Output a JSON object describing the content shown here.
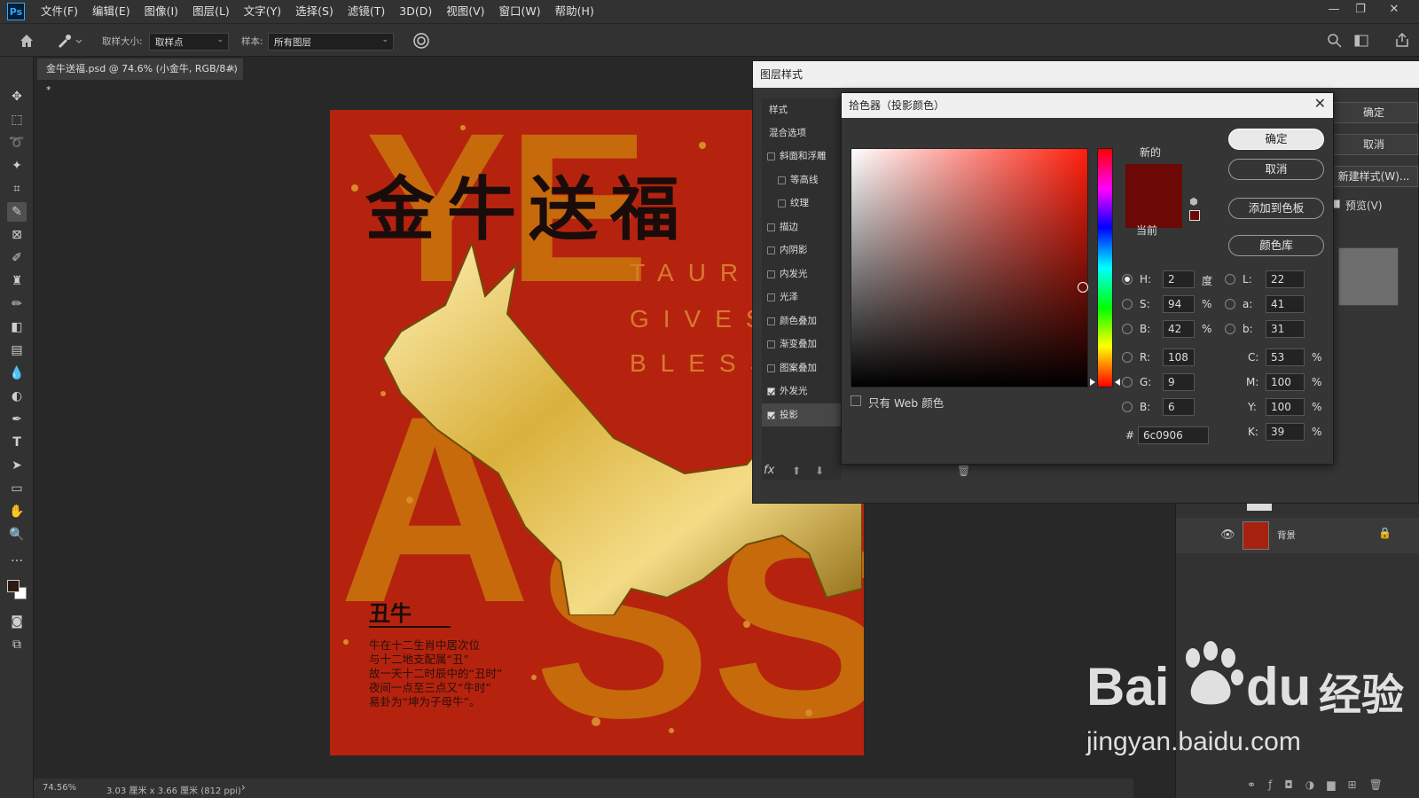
{
  "menubar": {
    "logo": "Ps",
    "items": [
      "文件(F)",
      "编辑(E)",
      "图像(I)",
      "图层(L)",
      "文字(Y)",
      "选择(S)",
      "滤镜(T)",
      "3D(D)",
      "视图(V)",
      "窗口(W)",
      "帮助(H)"
    ]
  },
  "optbar": {
    "sample_size_label": "取样大小:",
    "sample_size_value": "取样点",
    "sample_label": "样本:",
    "sample_value": "所有图层"
  },
  "document_tab": {
    "title": "金牛送福.psd @ 74.6% (小金牛, RGB/8#) *",
    "close": "×"
  },
  "poster": {
    "title": "金牛送福",
    "subtitle_lines": [
      "TAURUS",
      "GIVES",
      "BLESSI"
    ],
    "heading": "丑牛",
    "body_lines": [
      "牛在十二生肖中居次位",
      "与十二地支配属“丑”",
      "故一天十二时辰中的“丑时”",
      "夜间一点至三点又“牛时”",
      "易卦为“坤为子母牛”。"
    ]
  },
  "statusbar": {
    "zoom": "74.56%",
    "doc_size": "3.03 厘米 x 3.66 厘米 (812 ppi)",
    "arrow": "›"
  },
  "layer_style": {
    "title": "图层样式",
    "styles_header": "样式",
    "blend_options": "混合选项",
    "items": [
      {
        "label": "斜面和浮雕",
        "checked": false,
        "indent": false
      },
      {
        "label": "等高线",
        "checked": false,
        "indent": true
      },
      {
        "label": "纹理",
        "checked": false,
        "indent": true
      },
      {
        "label": "描边",
        "checked": false,
        "indent": false
      },
      {
        "label": "内阴影",
        "checked": false,
        "indent": false
      },
      {
        "label": "内发光",
        "checked": false,
        "indent": false
      },
      {
        "label": "光泽",
        "checked": false,
        "indent": false
      },
      {
        "label": "颜色叠加",
        "checked": false,
        "indent": false
      },
      {
        "label": "渐变叠加",
        "checked": false,
        "indent": false
      },
      {
        "label": "图案叠加",
        "checked": false,
        "indent": false
      },
      {
        "label": "外发光",
        "checked": true,
        "indent": false
      },
      {
        "label": "投影",
        "checked": true,
        "indent": false
      }
    ],
    "ok_button": "确定",
    "cancel_button": "取消",
    "new_style_button": "新建样式(W)...",
    "preview_label": "预览(V)",
    "fx_label": "fx"
  },
  "color_picker": {
    "title": "拾色器（投影颜色）",
    "new_label": "新的",
    "current_label": "当前",
    "web_only_label": "只有 Web 颜色",
    "ok_button": "确定",
    "cancel_button": "取消",
    "add_swatch_button": "添加到色板",
    "color_library_button": "颜色库",
    "new_color": "#6c0906",
    "current_color": "#6c0906",
    "hsb": {
      "H": "2",
      "S": "94",
      "B": "42",
      "h_unit": "度",
      "pct": "%"
    },
    "rgb": {
      "R": "108",
      "G": "9",
      "B": "6"
    },
    "lab": {
      "L": "22",
      "a": "41",
      "b": "31"
    },
    "cmyk": {
      "C": "53",
      "M": "100",
      "Y": "100",
      "K": "39"
    },
    "hex": "6c0906",
    "labels": {
      "H": "H:",
      "S": "S:",
      "B": "B:",
      "R": "R:",
      "G": "G:",
      "B2": "B:",
      "L": "L:",
      "a": "a:",
      "b": "b:",
      "C": "C:",
      "M": "M:",
      "Y": "Y:",
      "K": "K:",
      "hash": "#"
    }
  },
  "layers_panel": {
    "layer_name": "背景"
  },
  "watermark": {
    "brand": "Bai",
    "brand2": "du",
    "cn": "经验",
    "url": "jingyan.baidu.com"
  }
}
